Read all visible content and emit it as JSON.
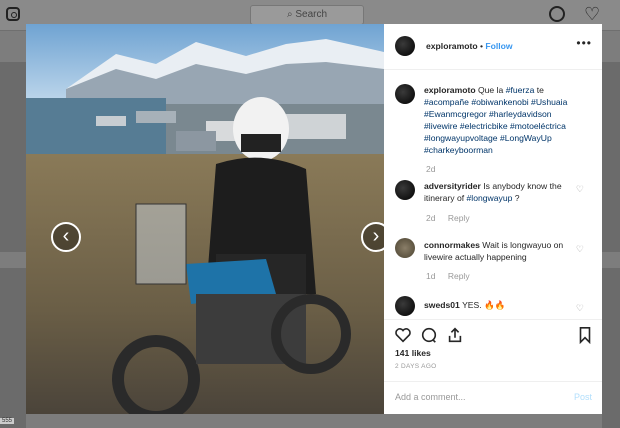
{
  "topbar": {
    "search_placeholder": "Search"
  },
  "post": {
    "username": "exploramoto",
    "follow_label": "Follow",
    "separator": "•",
    "caption_user": "exploramoto",
    "caption_text_1": "Que la ",
    "caption_tags": [
      "#fuerza",
      "#acompañe",
      "#obiwankenobi",
      "#Ushuaia",
      "#Ewanmcgregor",
      "#harleydavidson",
      "#livewire",
      "#electricbike",
      "#motoeléctrica",
      "#longwayupvoltage",
      "#LongWayUp",
      "#charkeyboorman"
    ],
    "caption_join_1": " te ",
    "caption_age": "2d",
    "comments": [
      {
        "user": "adversityrider",
        "text": "Is anybody know the itinerary of ",
        "tag": "#longwayup",
        "tail": " ?",
        "age": "2d",
        "reply": "Reply"
      },
      {
        "user": "connormakes",
        "text": "Wait is longwayuo on livewire actually happening",
        "age": "1d",
        "reply": "Reply"
      },
      {
        "user": "sweds01",
        "text": "YES. 🔥🔥"
      }
    ],
    "likes": "141 likes",
    "time_ago": "2 DAYS AGO",
    "add_comment_placeholder": "Add a comment...",
    "post_button": "Post"
  },
  "overlay": {
    "corner_text": "555"
  },
  "icons": [
    "instagram-logo-icon",
    "search-icon",
    "compass-icon",
    "heart-icon",
    "chevron-left-icon",
    "chevron-right-icon",
    "more-icon",
    "comment-icon",
    "share-icon",
    "bookmark-icon"
  ]
}
